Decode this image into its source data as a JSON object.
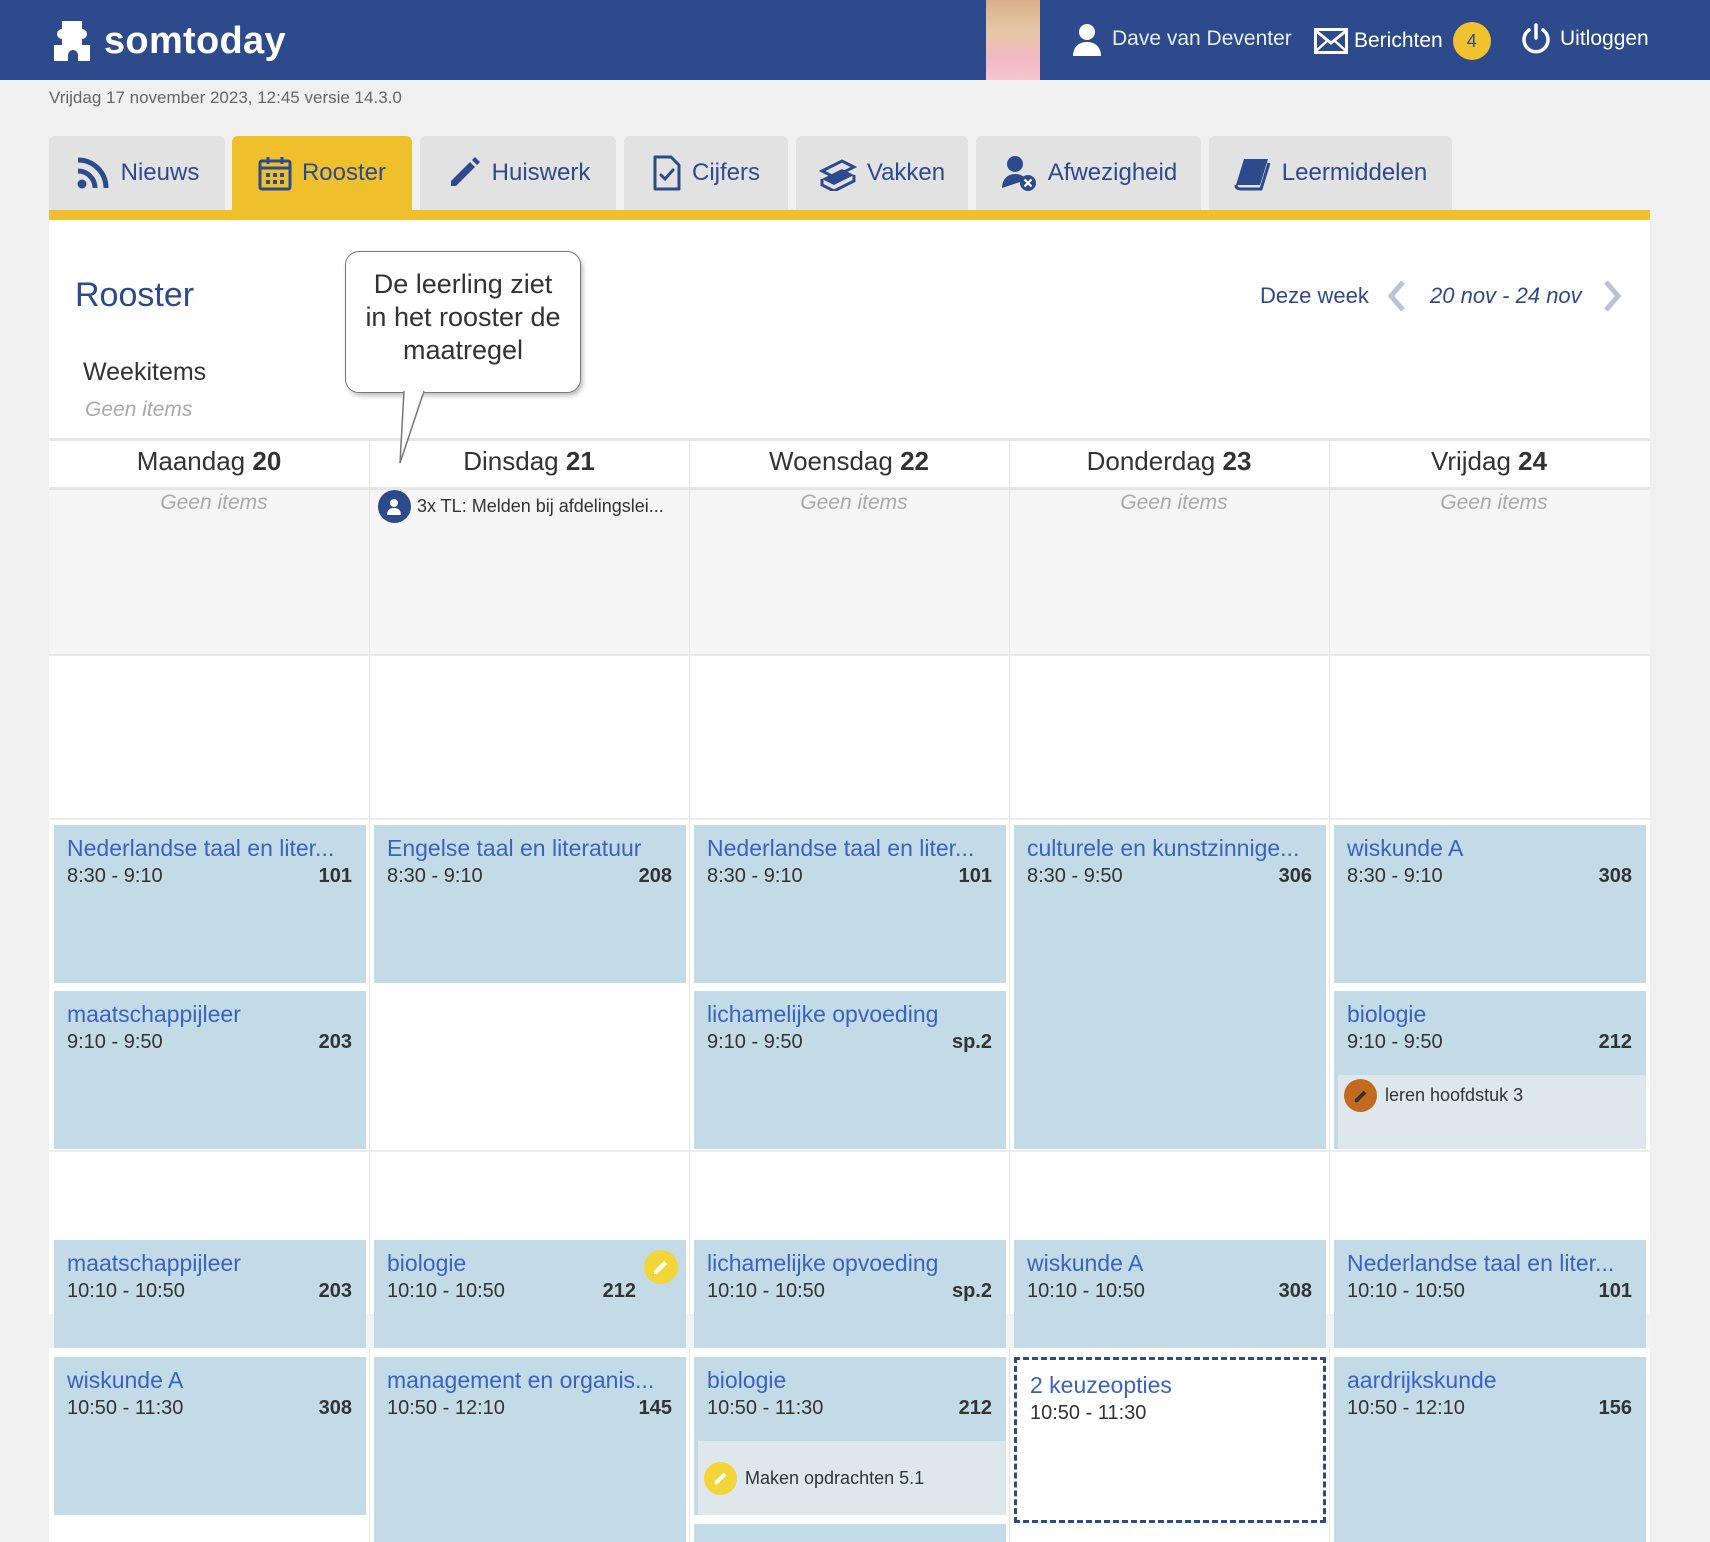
{
  "header": {
    "app_name": "somtoday",
    "user_name": "Dave van Deventer",
    "messages_label": "Berichten",
    "messages_count": "4",
    "logout_label": "Uitloggen"
  },
  "status_line": "Vrijdag 17 november 2023, 12:45 versie 14.3.0",
  "tabs": [
    {
      "label": "Nieuws",
      "icon": "rss-icon"
    },
    {
      "label": "Rooster",
      "icon": "calendar-icon",
      "active": true
    },
    {
      "label": "Huiswerk",
      "icon": "pencil-icon"
    },
    {
      "label": "Cijfers",
      "icon": "document-check-icon"
    },
    {
      "label": "Vakken",
      "icon": "books-icon"
    },
    {
      "label": "Afwezigheid",
      "icon": "user-absent-icon"
    },
    {
      "label": "Leermiddelen",
      "icon": "book-icon"
    }
  ],
  "page": {
    "title": "Rooster",
    "weekitems_label": "Weekitems",
    "weekitems_empty": "Geen items",
    "this_week": "Deze week",
    "week_range": "20 nov - 24 nov"
  },
  "callout": {
    "line1": "De leerling ziet",
    "line2": "in het rooster de",
    "line3": "maatregel"
  },
  "days": [
    {
      "name": "Maandag",
      "num": "20",
      "items_empty": "Geen items"
    },
    {
      "name": "Dinsdag",
      "num": "21",
      "item": "3x TL: Melden bij afdelingslei..."
    },
    {
      "name": "Woensdag",
      "num": "22",
      "items_empty": "Geen items"
    },
    {
      "name": "Donderdag",
      "num": "23",
      "items_empty": "Geen items"
    },
    {
      "name": "Vrijdag",
      "num": "24",
      "items_empty": "Geen items"
    }
  ],
  "lessons": {
    "mon": [
      {
        "subject": "Nederlandse taal en liter...",
        "time": "8:30 - 9:10",
        "room": "101"
      },
      {
        "subject": "maatschappijleer",
        "time": "9:10 - 9:50",
        "room": "203"
      },
      {
        "subject": "maatschappijleer",
        "time": "10:10 - 10:50",
        "room": "203"
      },
      {
        "subject": "wiskunde A",
        "time": "10:50 - 11:30",
        "room": "308"
      }
    ],
    "tue": [
      {
        "subject": "Engelse taal en literatuur",
        "time": "8:30 - 9:10",
        "room": "208"
      },
      {
        "subject": "biologie",
        "time": "10:10 - 10:50",
        "room": "212"
      },
      {
        "subject": "management en organis...",
        "time": "10:50 - 12:10",
        "room": "145"
      }
    ],
    "wed": [
      {
        "subject": "Nederlandse taal en liter...",
        "time": "8:30 - 9:10",
        "room": "101"
      },
      {
        "subject": "lichamelijke opvoeding",
        "time": "9:10 - 9:50",
        "room": "sp.2"
      },
      {
        "subject": "lichamelijke opvoeding",
        "time": "10:10 - 10:50",
        "room": "sp.2"
      },
      {
        "subject": "biologie",
        "time": "10:50 - 11:30",
        "room": "212",
        "homework": "Maken opdrachten 5.1"
      }
    ],
    "thu": [
      {
        "subject": "culturele en kunstzinnige...",
        "time": "8:30 - 9:50",
        "room": "306"
      },
      {
        "subject": "wiskunde A",
        "time": "10:10 - 10:50",
        "room": "308"
      },
      {
        "subject": "2 keuzeopties",
        "time": "10:50 - 11:30"
      }
    ],
    "fri": [
      {
        "subject": "wiskunde A",
        "time": "8:30 - 9:10",
        "room": "308"
      },
      {
        "subject": "biologie",
        "time": "9:10 - 9:50",
        "room": "212",
        "homework": "leren hoofdstuk 3"
      },
      {
        "subject": "Nederlandse taal en liter...",
        "time": "10:10 - 10:50",
        "room": "101"
      },
      {
        "subject": "aardrijkskunde",
        "time": "10:50 - 12:10",
        "room": "156"
      }
    ]
  },
  "colors": {
    "header_bg": "#2d4a8c",
    "accent_yellow": "#f0c02c",
    "lesson_bg": "#c2dbe6",
    "subject_text": "#3a62c0"
  }
}
